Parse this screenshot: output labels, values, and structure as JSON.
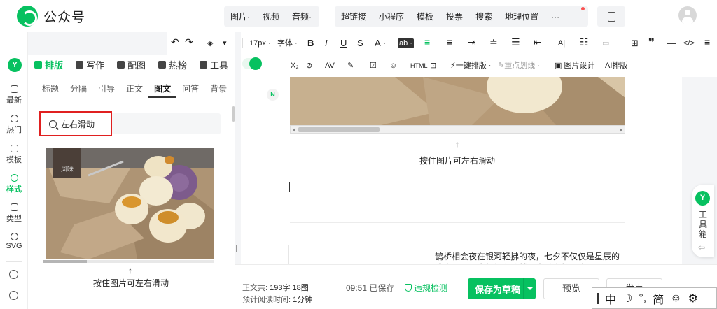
{
  "app": {
    "name": "公众号"
  },
  "header": {
    "insert_group_1": [
      "图片·",
      "视频",
      "音频·"
    ],
    "insert_group_2": [
      "超链接",
      "小程序",
      "模板",
      "投票",
      "搜索",
      "地理位置",
      "···"
    ]
  },
  "rail": {
    "logo": "Y",
    "items": [
      "最新",
      "热门",
      "模板",
      "样式",
      "类型",
      "SVG"
    ]
  },
  "panel": {
    "tabs": [
      "排版",
      "写作",
      "配图",
      "热榜",
      "工具"
    ],
    "subtabs": [
      "标题",
      "分隔",
      "引导",
      "正文",
      "图文",
      "问答",
      "背景"
    ],
    "search": {
      "value": "左右滑动"
    },
    "arrow": "↑",
    "caption": "按住图片可左右滑动"
  },
  "toolbar": {
    "row1": {
      "font_size": "17px ·",
      "font_family": "字体 ·",
      "bold": "B",
      "italic": "I",
      "underline": "U",
      "strike": "S",
      "font_color": "A ·",
      "bg_color": "ab ·"
    },
    "row2": {
      "subscript": "X₂",
      "one_click": "一键排版 ·",
      "highlight": "重点划线 ·",
      "image_design": "图片设计",
      "ai_layout": "AI排版"
    }
  },
  "editor": {
    "arrow": "↑",
    "caption": "按住图片可左右滑动",
    "card_text": "鹊桥相会夜在银河轻拂的夜，七夕不仅仅是星辰的盛宴，更是牛郎织女跨越万水千山的重逢",
    "ai_badge": "N"
  },
  "side_tools": {
    "logo": "Y",
    "label": "工具箱",
    "arrow": "⇦"
  },
  "bottom": {
    "word_label": "正文共:",
    "word_value": "193字 18图",
    "read_label": "预计阅读时间:",
    "read_value": "1分钟",
    "saved": "09:51 已保存",
    "check": "违规检测",
    "save_draft": "保存为草稿",
    "preview": "预览",
    "publish": "发表"
  },
  "ime": [
    "中",
    "☽",
    "°,",
    "简",
    "☺",
    "⚙"
  ],
  "colors": {
    "brand": "#07c160",
    "alert": "#fa5151",
    "highlight_border": "#e02020"
  }
}
